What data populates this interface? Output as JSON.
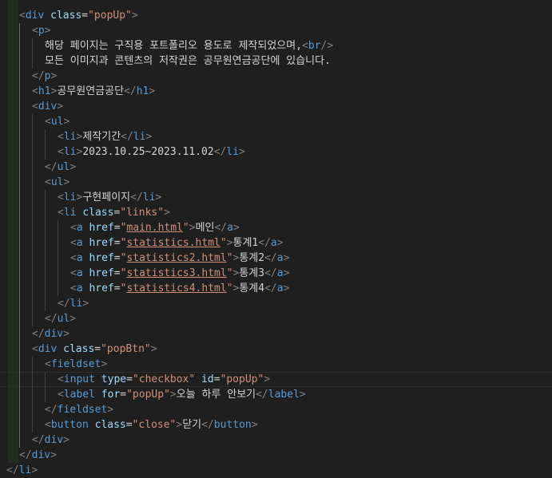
{
  "code": {
    "lines": [
      [
        [
          "tb",
          "<"
        ],
        [
          "tg",
          "div"
        ],
        [
          "tx",
          " "
        ],
        [
          "at",
          "class"
        ],
        [
          "eq",
          "="
        ],
        [
          "av",
          "\"popUp\""
        ],
        [
          "tb",
          ">"
        ]
      ],
      [
        [
          "tb",
          "<"
        ],
        [
          "tg",
          "p"
        ],
        [
          "tb",
          ">"
        ]
      ],
      [
        [
          "tx",
          "해당 페이지는 구직용 포트폴리오 용도로 제작되었으며,"
        ],
        [
          "tb",
          "<"
        ],
        [
          "tg",
          "br"
        ],
        [
          "tb",
          "/>"
        ]
      ],
      [
        [
          "tx",
          "모든 이미지과 콘텐츠의 저작권은 공무원연금공단에 있습니다."
        ]
      ],
      [
        [
          "tb",
          "</"
        ],
        [
          "tg",
          "p"
        ],
        [
          "tb",
          ">"
        ]
      ],
      [
        [
          "tb",
          "<"
        ],
        [
          "tg",
          "h1"
        ],
        [
          "tb",
          ">"
        ],
        [
          "tx",
          "공무원연금공단"
        ],
        [
          "tb",
          "</"
        ],
        [
          "tg",
          "h1"
        ],
        [
          "tb",
          ">"
        ]
      ],
      [
        [
          "tb",
          "<"
        ],
        [
          "tg",
          "div"
        ],
        [
          "tb",
          ">"
        ]
      ],
      [
        [
          "tb",
          "<"
        ],
        [
          "tg",
          "ul"
        ],
        [
          "tb",
          ">"
        ]
      ],
      [
        [
          "tb",
          "<"
        ],
        [
          "tg",
          "li"
        ],
        [
          "tb",
          ">"
        ],
        [
          "tx",
          "제작기간"
        ],
        [
          "tb",
          "</"
        ],
        [
          "tg",
          "li"
        ],
        [
          "tb",
          ">"
        ]
      ],
      [
        [
          "tb",
          "<"
        ],
        [
          "tg",
          "li"
        ],
        [
          "tb",
          ">"
        ],
        [
          "tx",
          "2023.10.25~2023.11.02"
        ],
        [
          "tb",
          "</"
        ],
        [
          "tg",
          "li"
        ],
        [
          "tb",
          ">"
        ]
      ],
      [
        [
          "tb",
          "</"
        ],
        [
          "tg",
          "ul"
        ],
        [
          "tb",
          ">"
        ]
      ],
      [
        [
          "tb",
          "<"
        ],
        [
          "tg",
          "ul"
        ],
        [
          "tb",
          ">"
        ]
      ],
      [
        [
          "tb",
          "<"
        ],
        [
          "tg",
          "li"
        ],
        [
          "tb",
          ">"
        ],
        [
          "tx",
          "구현페이지"
        ],
        [
          "tb",
          "</"
        ],
        [
          "tg",
          "li"
        ],
        [
          "tb",
          ">"
        ]
      ],
      [
        [
          "tb",
          "<"
        ],
        [
          "tg",
          "li"
        ],
        [
          "tx",
          " "
        ],
        [
          "at",
          "class"
        ],
        [
          "eq",
          "="
        ],
        [
          "av",
          "\"links\""
        ],
        [
          "tb",
          ">"
        ]
      ],
      [
        [
          "tb",
          "<"
        ],
        [
          "tg",
          "a"
        ],
        [
          "tx",
          " "
        ],
        [
          "at",
          "href"
        ],
        [
          "eq",
          "="
        ],
        [
          "av",
          "\""
        ],
        [
          "avu",
          "main.html"
        ],
        [
          "av",
          "\""
        ],
        [
          "tb",
          ">"
        ],
        [
          "tx",
          "메인"
        ],
        [
          "tb",
          "</"
        ],
        [
          "tg",
          "a"
        ],
        [
          "tb",
          ">"
        ]
      ],
      [
        [
          "tb",
          "<"
        ],
        [
          "tg",
          "a"
        ],
        [
          "tx",
          " "
        ],
        [
          "at",
          "href"
        ],
        [
          "eq",
          "="
        ],
        [
          "av",
          "\""
        ],
        [
          "avu",
          "statistics.html"
        ],
        [
          "av",
          "\""
        ],
        [
          "tb",
          ">"
        ],
        [
          "tx",
          "통계1"
        ],
        [
          "tb",
          "</"
        ],
        [
          "tg",
          "a"
        ],
        [
          "tb",
          ">"
        ]
      ],
      [
        [
          "tb",
          "<"
        ],
        [
          "tg",
          "a"
        ],
        [
          "tx",
          " "
        ],
        [
          "at",
          "href"
        ],
        [
          "eq",
          "="
        ],
        [
          "av",
          "\""
        ],
        [
          "avu",
          "statistics2.html"
        ],
        [
          "av",
          "\""
        ],
        [
          "tb",
          ">"
        ],
        [
          "tx",
          "통계2"
        ],
        [
          "tb",
          "</"
        ],
        [
          "tg",
          "a"
        ],
        [
          "tb",
          ">"
        ]
      ],
      [
        [
          "tb",
          "<"
        ],
        [
          "tg",
          "a"
        ],
        [
          "tx",
          " "
        ],
        [
          "at",
          "href"
        ],
        [
          "eq",
          "="
        ],
        [
          "av",
          "\""
        ],
        [
          "avu",
          "statistics3.html"
        ],
        [
          "av",
          "\""
        ],
        [
          "tb",
          ">"
        ],
        [
          "tx",
          "통계3"
        ],
        [
          "tb",
          "</"
        ],
        [
          "tg",
          "a"
        ],
        [
          "tb",
          ">"
        ]
      ],
      [
        [
          "tb",
          "<"
        ],
        [
          "tg",
          "a"
        ],
        [
          "tx",
          " "
        ],
        [
          "at",
          "href"
        ],
        [
          "eq",
          "="
        ],
        [
          "av",
          "\""
        ],
        [
          "avu",
          "statistics4.html"
        ],
        [
          "av",
          "\""
        ],
        [
          "tb",
          ">"
        ],
        [
          "tx",
          "통계4"
        ],
        [
          "tb",
          "</"
        ],
        [
          "tg",
          "a"
        ],
        [
          "tb",
          ">"
        ]
      ],
      [
        [
          "tb",
          "</"
        ],
        [
          "tg",
          "li"
        ],
        [
          "tb",
          ">"
        ]
      ],
      [
        [
          "tb",
          "</"
        ],
        [
          "tg",
          "ul"
        ],
        [
          "tb",
          ">"
        ]
      ],
      [
        [
          "tb",
          "</"
        ],
        [
          "tg",
          "div"
        ],
        [
          "tb",
          ">"
        ]
      ],
      [
        [
          "tb",
          "<"
        ],
        [
          "tg",
          "div"
        ],
        [
          "tx",
          " "
        ],
        [
          "at",
          "class"
        ],
        [
          "eq",
          "="
        ],
        [
          "av",
          "\"popBtn\""
        ],
        [
          "tb",
          ">"
        ]
      ],
      [
        [
          "tb",
          "<"
        ],
        [
          "tg",
          "fieldset"
        ],
        [
          "tb",
          ">"
        ]
      ],
      [
        [
          "tb",
          "<"
        ],
        [
          "tg",
          "input"
        ],
        [
          "tx",
          " "
        ],
        [
          "at",
          "type"
        ],
        [
          "eq",
          "="
        ],
        [
          "av",
          "\"checkbox\""
        ],
        [
          "tx",
          " "
        ],
        [
          "at",
          "id"
        ],
        [
          "eq",
          "="
        ],
        [
          "av",
          "\"popUp\""
        ],
        [
          "tb",
          ">"
        ]
      ],
      [
        [
          "tb",
          "<"
        ],
        [
          "tg",
          "label"
        ],
        [
          "tx",
          " "
        ],
        [
          "at",
          "for"
        ],
        [
          "eq",
          "="
        ],
        [
          "av",
          "\"popUp\""
        ],
        [
          "tb",
          ">"
        ],
        [
          "tx",
          "오늘 하루 안보기"
        ],
        [
          "tb",
          "</"
        ],
        [
          "tg",
          "label"
        ],
        [
          "tb",
          ">"
        ]
      ],
      [
        [
          "tb",
          "</"
        ],
        [
          "tg",
          "fieldset"
        ],
        [
          "tb",
          ">"
        ]
      ],
      [
        [
          "tb",
          "<"
        ],
        [
          "tg",
          "button"
        ],
        [
          "tx",
          " "
        ],
        [
          "at",
          "class"
        ],
        [
          "eq",
          "="
        ],
        [
          "av",
          "\"close\""
        ],
        [
          "tb",
          ">"
        ],
        [
          "tx",
          "닫기"
        ],
        [
          "tb",
          "</"
        ],
        [
          "tg",
          "button"
        ],
        [
          "tb",
          ">"
        ]
      ],
      [
        [
          "tb",
          "</"
        ],
        [
          "tg",
          "div"
        ],
        [
          "tb",
          ">"
        ]
      ],
      [
        [
          "tb",
          "</"
        ],
        [
          "tg",
          "div"
        ],
        [
          "tb",
          ">"
        ]
      ],
      [
        [
          "tb",
          "</"
        ],
        [
          "tg",
          "li"
        ],
        [
          "tb",
          ">"
        ]
      ]
    ],
    "indents": [
      1,
      2,
      3,
      3,
      2,
      2,
      2,
      3,
      4,
      4,
      3,
      3,
      4,
      4,
      5,
      5,
      5,
      5,
      5,
      4,
      3,
      2,
      2,
      3,
      4,
      4,
      3,
      3,
      2,
      1,
      0
    ]
  },
  "colors": {
    "background": "#1f1f1f",
    "bracket": "#808080",
    "tag": "#569cd6",
    "attribute": "#9cdcfe",
    "string": "#ce9178",
    "text": "#d4d4d4"
  }
}
